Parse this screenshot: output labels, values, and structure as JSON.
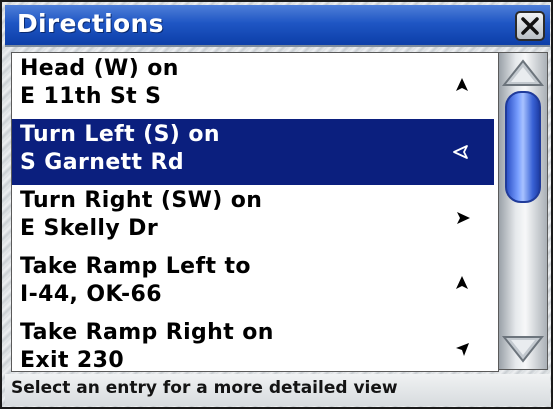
{
  "window": {
    "title": "Directions",
    "close_icon": "close-icon"
  },
  "directions": [
    {
      "line1": "Head (W) on",
      "line2": "E 11th St S",
      "arrow": "arrow-up-icon",
      "selected": false
    },
    {
      "line1": "Turn Left (S) on",
      "line2": "S Garnett Rd",
      "arrow": "arrow-left-icon",
      "selected": true
    },
    {
      "line1": "Turn Right (SW) on",
      "line2": "E Skelly Dr",
      "arrow": "arrow-right-icon",
      "selected": false
    },
    {
      "line1": "Take Ramp Left to",
      "line2": "I-44, OK-66",
      "arrow": "arrow-up-icon",
      "selected": false
    },
    {
      "line1": "Take Ramp Right on",
      "line2": "Exit 230",
      "arrow": "arrow-up-right-icon",
      "selected": false
    }
  ],
  "status": {
    "hint": "Select an entry for a more detailed view"
  },
  "colors": {
    "title_bar": "#1f56c4",
    "selection": "#0b1f7e",
    "scroll_thumb": "#5a80ee"
  }
}
